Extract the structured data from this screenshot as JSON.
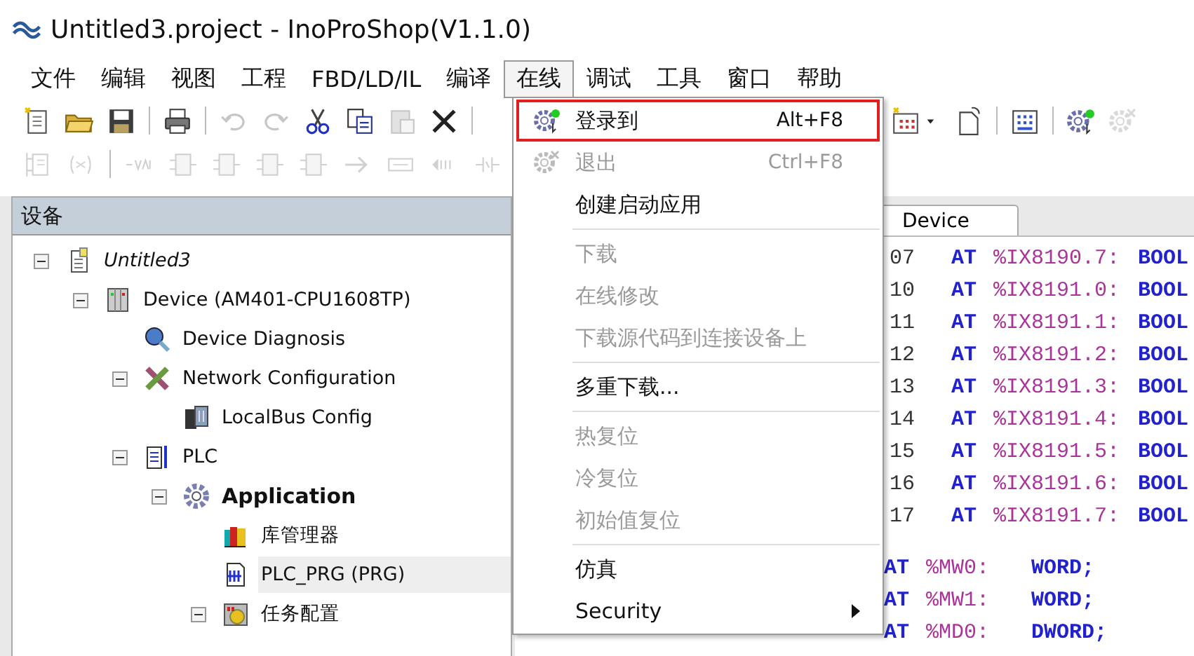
{
  "window": {
    "title": "Untitled3.project - InoProShop(V1.1.0)"
  },
  "menubar": [
    {
      "label": "文件",
      "selected": false
    },
    {
      "label": "编辑",
      "selected": false
    },
    {
      "label": "视图",
      "selected": false
    },
    {
      "label": "工程",
      "selected": false
    },
    {
      "label": "FBD/LD/IL",
      "selected": false
    },
    {
      "label": "编译",
      "selected": false
    },
    {
      "label": "在线",
      "selected": true
    },
    {
      "label": "调试",
      "selected": false
    },
    {
      "label": "工具",
      "selected": false
    },
    {
      "label": "窗口",
      "selected": false
    },
    {
      "label": "帮助",
      "selected": false
    }
  ],
  "toolbar": [
    {
      "kind": "new",
      "disabled": false
    },
    {
      "kind": "open",
      "disabled": false
    },
    {
      "kind": "save",
      "disabled": false
    },
    {
      "kind": "sep"
    },
    {
      "kind": "print",
      "disabled": false
    },
    {
      "kind": "sep"
    },
    {
      "kind": "undo",
      "disabled": true
    },
    {
      "kind": "redo",
      "disabled": true
    },
    {
      "kind": "cut",
      "disabled": false
    },
    {
      "kind": "copy",
      "disabled": false
    },
    {
      "kind": "paste",
      "disabled": true
    },
    {
      "kind": "delete",
      "disabled": false
    },
    {
      "kind": "sep"
    },
    {
      "kind": "gap"
    },
    {
      "kind": "sep"
    },
    {
      "kind": "table",
      "disabled": false
    },
    {
      "kind": "caret",
      "disabled": false
    },
    {
      "kind": "page",
      "disabled": false
    },
    {
      "kind": "sep"
    },
    {
      "kind": "grid",
      "disabled": false
    },
    {
      "kind": "sep"
    },
    {
      "kind": "login",
      "disabled": false
    },
    {
      "kind": "logout",
      "disabled": true
    }
  ],
  "toolbar2": [
    {
      "kind": "ladder",
      "disabled": true
    },
    {
      "kind": "bracket",
      "disabled": true
    },
    {
      "kind": "sep"
    },
    {
      "kind": "var",
      "disabled": true
    },
    {
      "kind": "box",
      "disabled": true
    },
    {
      "kind": "box",
      "disabled": true
    },
    {
      "kind": "box",
      "disabled": true
    },
    {
      "kind": "box",
      "disabled": true
    },
    {
      "kind": "arrow",
      "disabled": true
    },
    {
      "kind": "label",
      "disabled": true
    },
    {
      "kind": "ret",
      "disabled": true
    },
    {
      "kind": "coil",
      "disabled": true
    }
  ],
  "devices_panel": {
    "title": "设备",
    "tree": [
      {
        "label": "Untitled3",
        "kind": "project",
        "italic": true,
        "expanded": true,
        "selected": false,
        "children": [
          {
            "label": "Device (AM401-CPU1608TP)",
            "kind": "device",
            "expanded": true,
            "selected": false,
            "children": [
              {
                "label": "Device Diagnosis",
                "kind": "diagnosis",
                "selected": false
              },
              {
                "label": "Network Configuration",
                "kind": "network",
                "expanded": true,
                "selected": false,
                "children": [
                  {
                    "label": "LocalBus Config",
                    "kind": "localbus",
                    "selected": false
                  }
                ]
              },
              {
                "label": "PLC",
                "kind": "plc",
                "expanded": true,
                "selected": false,
                "children": [
                  {
                    "label": "Application",
                    "kind": "application",
                    "bold": true,
                    "expanded": true,
                    "selected": false,
                    "children": [
                      {
                        "label": "库管理器",
                        "kind": "library",
                        "selected": false
                      },
                      {
                        "label": "PLC_PRG (PRG)",
                        "kind": "pou",
                        "selected": true
                      },
                      {
                        "label": "任务配置",
                        "kind": "task",
                        "expanded": true,
                        "selected": false
                      }
                    ]
                  }
                ]
              }
            ]
          }
        ]
      }
    ]
  },
  "editor": {
    "tabs": [
      {
        "label": "Device",
        "selected": true
      }
    ],
    "lines": [
      {
        "kind": "io",
        "column_1": "07",
        "keyword": "AT",
        "address": "%IX8190.7:",
        "type": "BOOL"
      },
      {
        "kind": "io",
        "column_1": "10",
        "keyword": "AT",
        "address": "%IX8191.0:",
        "type": "BOOL"
      },
      {
        "kind": "io",
        "column_1": "11",
        "keyword": "AT",
        "address": "%IX8191.1:",
        "type": "BOOL"
      },
      {
        "kind": "io",
        "column_1": "12",
        "keyword": "AT",
        "address": "%IX8191.2:",
        "type": "BOOL"
      },
      {
        "kind": "io",
        "column_1": "13",
        "keyword": "AT",
        "address": "%IX8191.3:",
        "type": "BOOL"
      },
      {
        "kind": "io",
        "column_1": "14",
        "keyword": "AT",
        "address": "%IX8191.4:",
        "type": "BOOL"
      },
      {
        "kind": "io",
        "column_1": "15",
        "keyword": "AT",
        "address": "%IX8191.5:",
        "type": "BOOL"
      },
      {
        "kind": "io",
        "column_1": "16",
        "keyword": "AT",
        "address": "%IX8191.6:",
        "type": "BOOL"
      },
      {
        "kind": "io",
        "column_1": "17",
        "keyword": "AT",
        "address": "%IX8191.7:",
        "type": "BOOL"
      },
      {
        "kind": "blank"
      },
      {
        "kind": "var",
        "keyword": "AT",
        "address": "%MW0:",
        "type": "WORD;"
      },
      {
        "kind": "var",
        "keyword": "AT",
        "address": "%MW1:",
        "type": "WORD;"
      },
      {
        "kind": "var",
        "keyword": "AT",
        "address": "%MD0:",
        "type": "DWORD;"
      }
    ]
  },
  "online_menu": {
    "items": [
      {
        "kind": "login",
        "label": "登录到",
        "shortcut": "Alt+F8",
        "disabled": false,
        "highlighted": true
      },
      {
        "kind": "logout",
        "label": "退出",
        "shortcut": "Ctrl+F8",
        "disabled": true,
        "highlighted": false
      },
      {
        "kind": "item",
        "label": "创建启动应用",
        "disabled": false,
        "highlighted": false
      },
      {
        "kind": "separator"
      },
      {
        "kind": "item",
        "label": "下载",
        "disabled": true,
        "highlighted": false
      },
      {
        "kind": "item",
        "label": "在线修改",
        "disabled": true,
        "highlighted": false
      },
      {
        "kind": "item",
        "label": "下载源代码到连接设备上",
        "disabled": true,
        "highlighted": false
      },
      {
        "kind": "separator"
      },
      {
        "kind": "item",
        "label": "多重下载...",
        "disabled": false,
        "highlighted": false
      },
      {
        "kind": "separator"
      },
      {
        "kind": "item",
        "label": "热复位",
        "disabled": true,
        "highlighted": false
      },
      {
        "kind": "item",
        "label": "冷复位",
        "disabled": true,
        "highlighted": false
      },
      {
        "kind": "item",
        "label": "初始值复位",
        "disabled": true,
        "highlighted": false
      },
      {
        "kind": "separator"
      },
      {
        "kind": "item",
        "label": "仿真",
        "disabled": false,
        "highlighted": false
      },
      {
        "kind": "item",
        "label": "Security",
        "submenu": true,
        "disabled": false,
        "highlighted": false
      }
    ]
  }
}
